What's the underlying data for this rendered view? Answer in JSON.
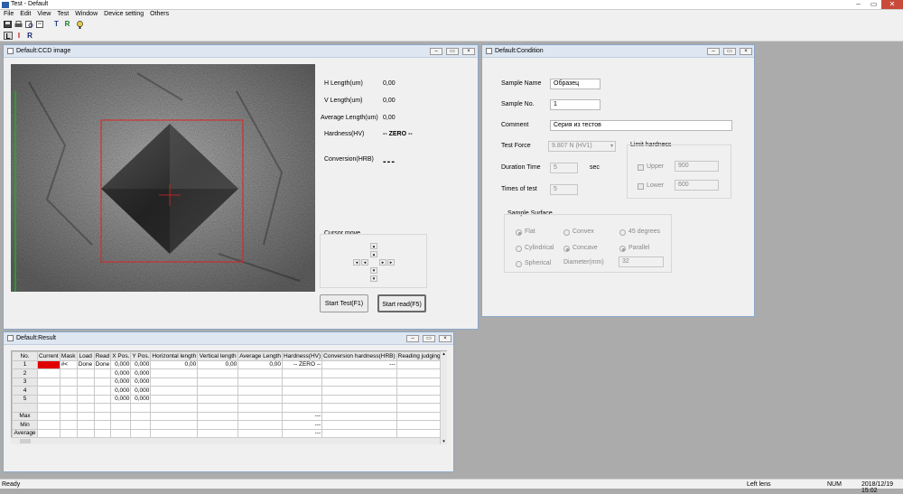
{
  "app": {
    "title": "Test - Default"
  },
  "menu": [
    "File",
    "Edit",
    "View",
    "Test",
    "Window",
    "Device setting",
    "Others"
  ],
  "toolbar": {
    "mode_buttons": [
      "L",
      "I",
      "R"
    ]
  },
  "ccd": {
    "title": "Default:CCD image",
    "h_length_label": "H Length(um)",
    "h_length_value": "0,00",
    "v_length_label": "V Length(um)",
    "v_length_value": "0,00",
    "avg_length_label": "Average Length(um)",
    "avg_length_value": "0,00",
    "hardness_label": "Hardness(HV)",
    "hardness_value": "-- ZERO --",
    "conversion_label": "Conversion(HRB)",
    "conversion_value": "---",
    "cursor_move_label": "Cursor move",
    "start_test_button": "Start Test(F1)",
    "start_read_button": "Start read(F5)"
  },
  "condition": {
    "title": "Default:Condition",
    "sample_name_label": "Sample Name",
    "sample_name_value": "Образец",
    "sample_no_label": "Sample No.",
    "sample_no_value": "1",
    "comment_label": "Comment",
    "comment_value": "Серия из тестов",
    "test_force_label": "Test Force",
    "test_force_value": "9.807 N (HV1)",
    "duration_label": "Duration Time",
    "duration_value": "5",
    "duration_unit": "sec",
    "times_label": "Times of test",
    "times_value": "5",
    "limit_title": "Limit hardness",
    "upper_label": "Upper",
    "upper_value": "900",
    "lower_label": "Lower",
    "lower_value": "600",
    "surface_title": "Sample Surface",
    "flat_label": "Flat",
    "convex_label": "Convex",
    "deg45_label": "45 degrees",
    "cylindrical_label": "Cylindrical",
    "concave_label": "Concave",
    "parallel_label": "Parallel",
    "spherical_label": "Spherical",
    "diameter_label": "Diameter(mm)",
    "diameter_value": "32"
  },
  "result": {
    "title": "Default:Result",
    "columns": [
      "No.",
      "Current",
      "Mask",
      "Load",
      "Read",
      "X Pos.",
      "Y Pos.",
      "Horizontal length",
      "Vertical length",
      "Average Length",
      "Hardness(HV)",
      "Conversion hardness(HRB)",
      "Reading judging"
    ],
    "rows": [
      [
        "1",
        "",
        "#<",
        "Done",
        "Done",
        "0,000",
        "0,000",
        "0,00",
        "0,00",
        "0,00",
        "-- ZERO --",
        "---",
        ""
      ],
      [
        "2",
        "",
        "",
        "",
        "",
        "0,000",
        "0,000",
        "",
        "",
        "",
        "",
        "",
        ""
      ],
      [
        "3",
        "",
        "",
        "",
        "",
        "0,000",
        "0,000",
        "",
        "",
        "",
        "",
        "",
        ""
      ],
      [
        "4",
        "",
        "",
        "",
        "",
        "0,000",
        "0,000",
        "",
        "",
        "",
        "",
        "",
        ""
      ],
      [
        "5",
        "",
        "",
        "",
        "",
        "0,000",
        "0,000",
        "",
        "",
        "",
        "",
        "",
        ""
      ],
      [
        "",
        "",
        "",
        "",
        "",
        "",
        "",
        "",
        "",
        "",
        "",
        "",
        ""
      ],
      [
        "Max",
        "",
        "",
        "",
        "",
        "",
        "",
        "",
        "",
        "",
        "---",
        "",
        ""
      ],
      [
        "Min",
        "",
        "",
        "",
        "",
        "",
        "",
        "",
        "",
        "",
        "---",
        "",
        ""
      ],
      [
        "Average",
        "",
        "",
        "",
        "",
        "",
        "",
        "",
        "",
        "",
        "---",
        "",
        ""
      ]
    ]
  },
  "status": {
    "ready": "Ready",
    "lens": "Left lens",
    "num": "NUM",
    "datetime": "2018/12/19 15:02"
  },
  "colors": {
    "current_marker": "#e00000",
    "overlay": "#e02020",
    "green_line": "#22aa22"
  }
}
